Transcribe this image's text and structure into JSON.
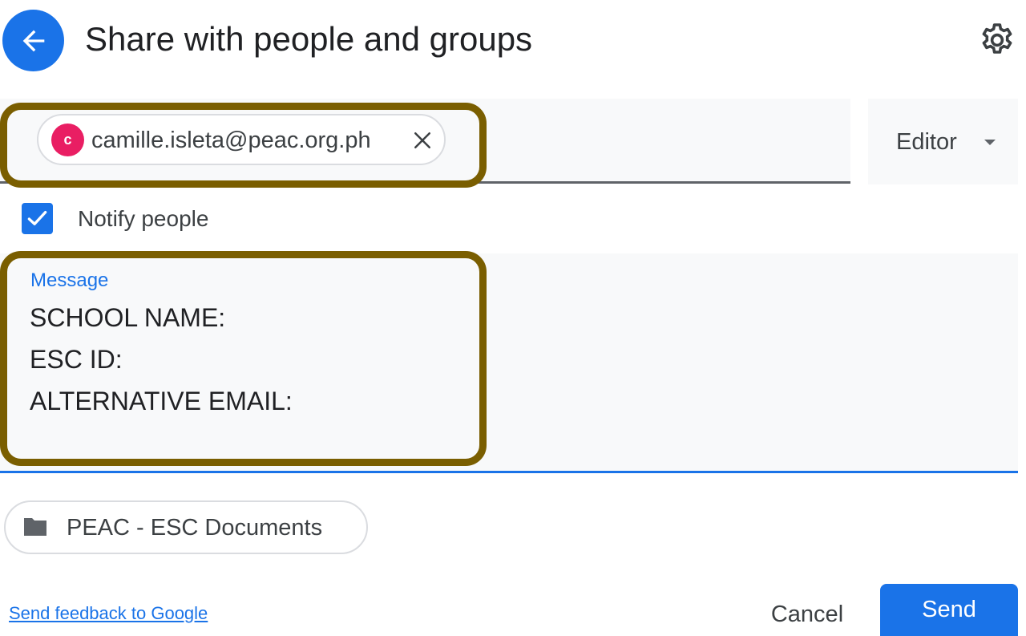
{
  "header": {
    "title": "Share with people and groups",
    "back_icon": "arrow-back-icon",
    "settings_icon": "gear-icon"
  },
  "recipients": {
    "chips": [
      {
        "avatar_initial": "c",
        "email": "camille.isleta@peac.org.ph",
        "avatar_color": "#e91e63"
      }
    ],
    "role": "Editor"
  },
  "notify": {
    "label": "Notify people",
    "checked": true
  },
  "message": {
    "label": "Message",
    "text": "SCHOOL NAME:\nESC ID:\nALTERNATIVE EMAIL:"
  },
  "folder": {
    "label": "PEAC - ESC Documents",
    "icon": "folder-icon"
  },
  "footer": {
    "feedback_link": "Send feedback to Google",
    "cancel_label": "Cancel",
    "send_label": "Send"
  },
  "colors": {
    "accent": "#1a73e8",
    "highlight": "#7a5e00",
    "field_bg": "#f8f9fa"
  }
}
